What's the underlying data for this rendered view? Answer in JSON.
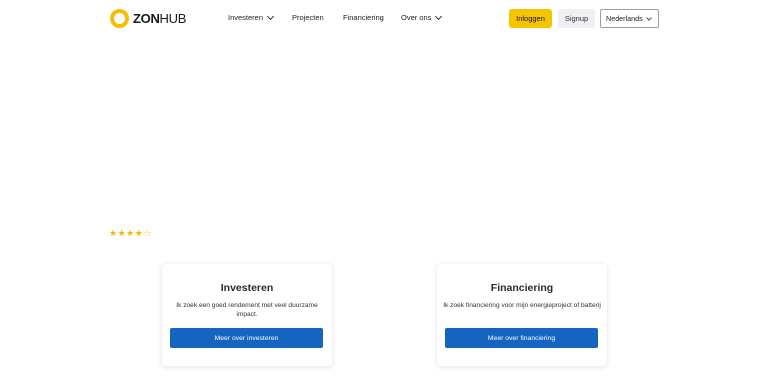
{
  "header": {
    "logo": {
      "bold": "ZON",
      "thin": "HUB"
    },
    "nav": [
      {
        "label": "Investeren",
        "has_dropdown": true
      },
      {
        "label": "Projecten",
        "has_dropdown": false
      },
      {
        "label": "Financiering",
        "has_dropdown": false
      },
      {
        "label": "Over ons",
        "has_dropdown": true
      }
    ],
    "login_label": "Inloggen",
    "signup_label": "Signup",
    "language": "Nederlands"
  },
  "rating": {
    "filled": 4,
    "total": 5
  },
  "cards": [
    {
      "title": "Investeren",
      "description": "Ik zoek een goed rendement met veel duurzame impact.",
      "button": "Meer over investeren"
    },
    {
      "title": "Financiering",
      "description": "Ik zoek financiering voor mijn energieproject of batterij",
      "button": "Meer over financiering"
    }
  ],
  "colors": {
    "brand_yellow": "#f6c500",
    "button_blue": "#1565c0",
    "star": "#f5b800"
  }
}
